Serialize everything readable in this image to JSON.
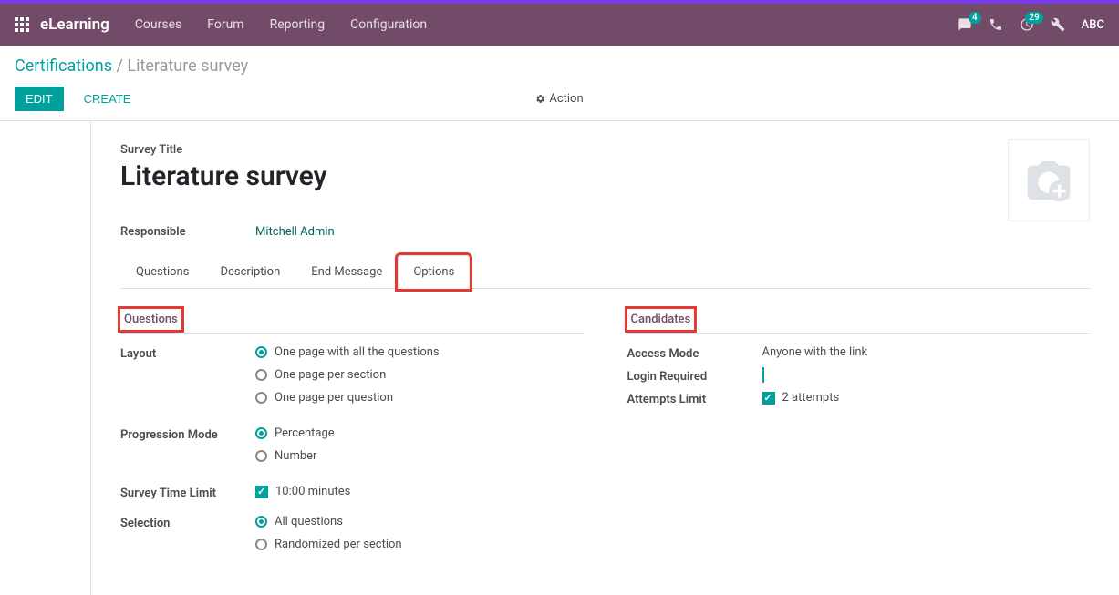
{
  "nav": {
    "brand": "eLearning",
    "links": [
      "Courses",
      "Forum",
      "Reporting",
      "Configuration"
    ],
    "badges": {
      "chat": "4",
      "activity": "29"
    },
    "user": "ABC"
  },
  "breadcrumb": {
    "root": "Certifications",
    "current": "Literature survey"
  },
  "toolbar": {
    "edit": "EDIT",
    "create": "CREATE",
    "action": "Action"
  },
  "survey": {
    "title_label": "Survey Title",
    "title": "Literature survey",
    "responsible_label": "Responsible",
    "responsible": "Mitchell Admin"
  },
  "tabs": [
    "Questions",
    "Description",
    "End Message",
    "Options"
  ],
  "options": {
    "left_section": "Questions",
    "right_section": "Candidates",
    "layout": {
      "label": "Layout",
      "choices": [
        "One page with all the questions",
        "One page per section",
        "One page per question"
      ]
    },
    "progression": {
      "label": "Progression Mode",
      "choices": [
        "Percentage",
        "Number"
      ]
    },
    "time_limit": {
      "label": "Survey Time Limit",
      "value": "10:00 minutes"
    },
    "selection": {
      "label": "Selection",
      "choices": [
        "All questions",
        "Randomized per section"
      ]
    },
    "access_mode": {
      "label": "Access Mode",
      "value": "Anyone with the link"
    },
    "login_required": {
      "label": "Login Required"
    },
    "attempts": {
      "label": "Attempts Limit",
      "value": "2 attempts"
    }
  }
}
